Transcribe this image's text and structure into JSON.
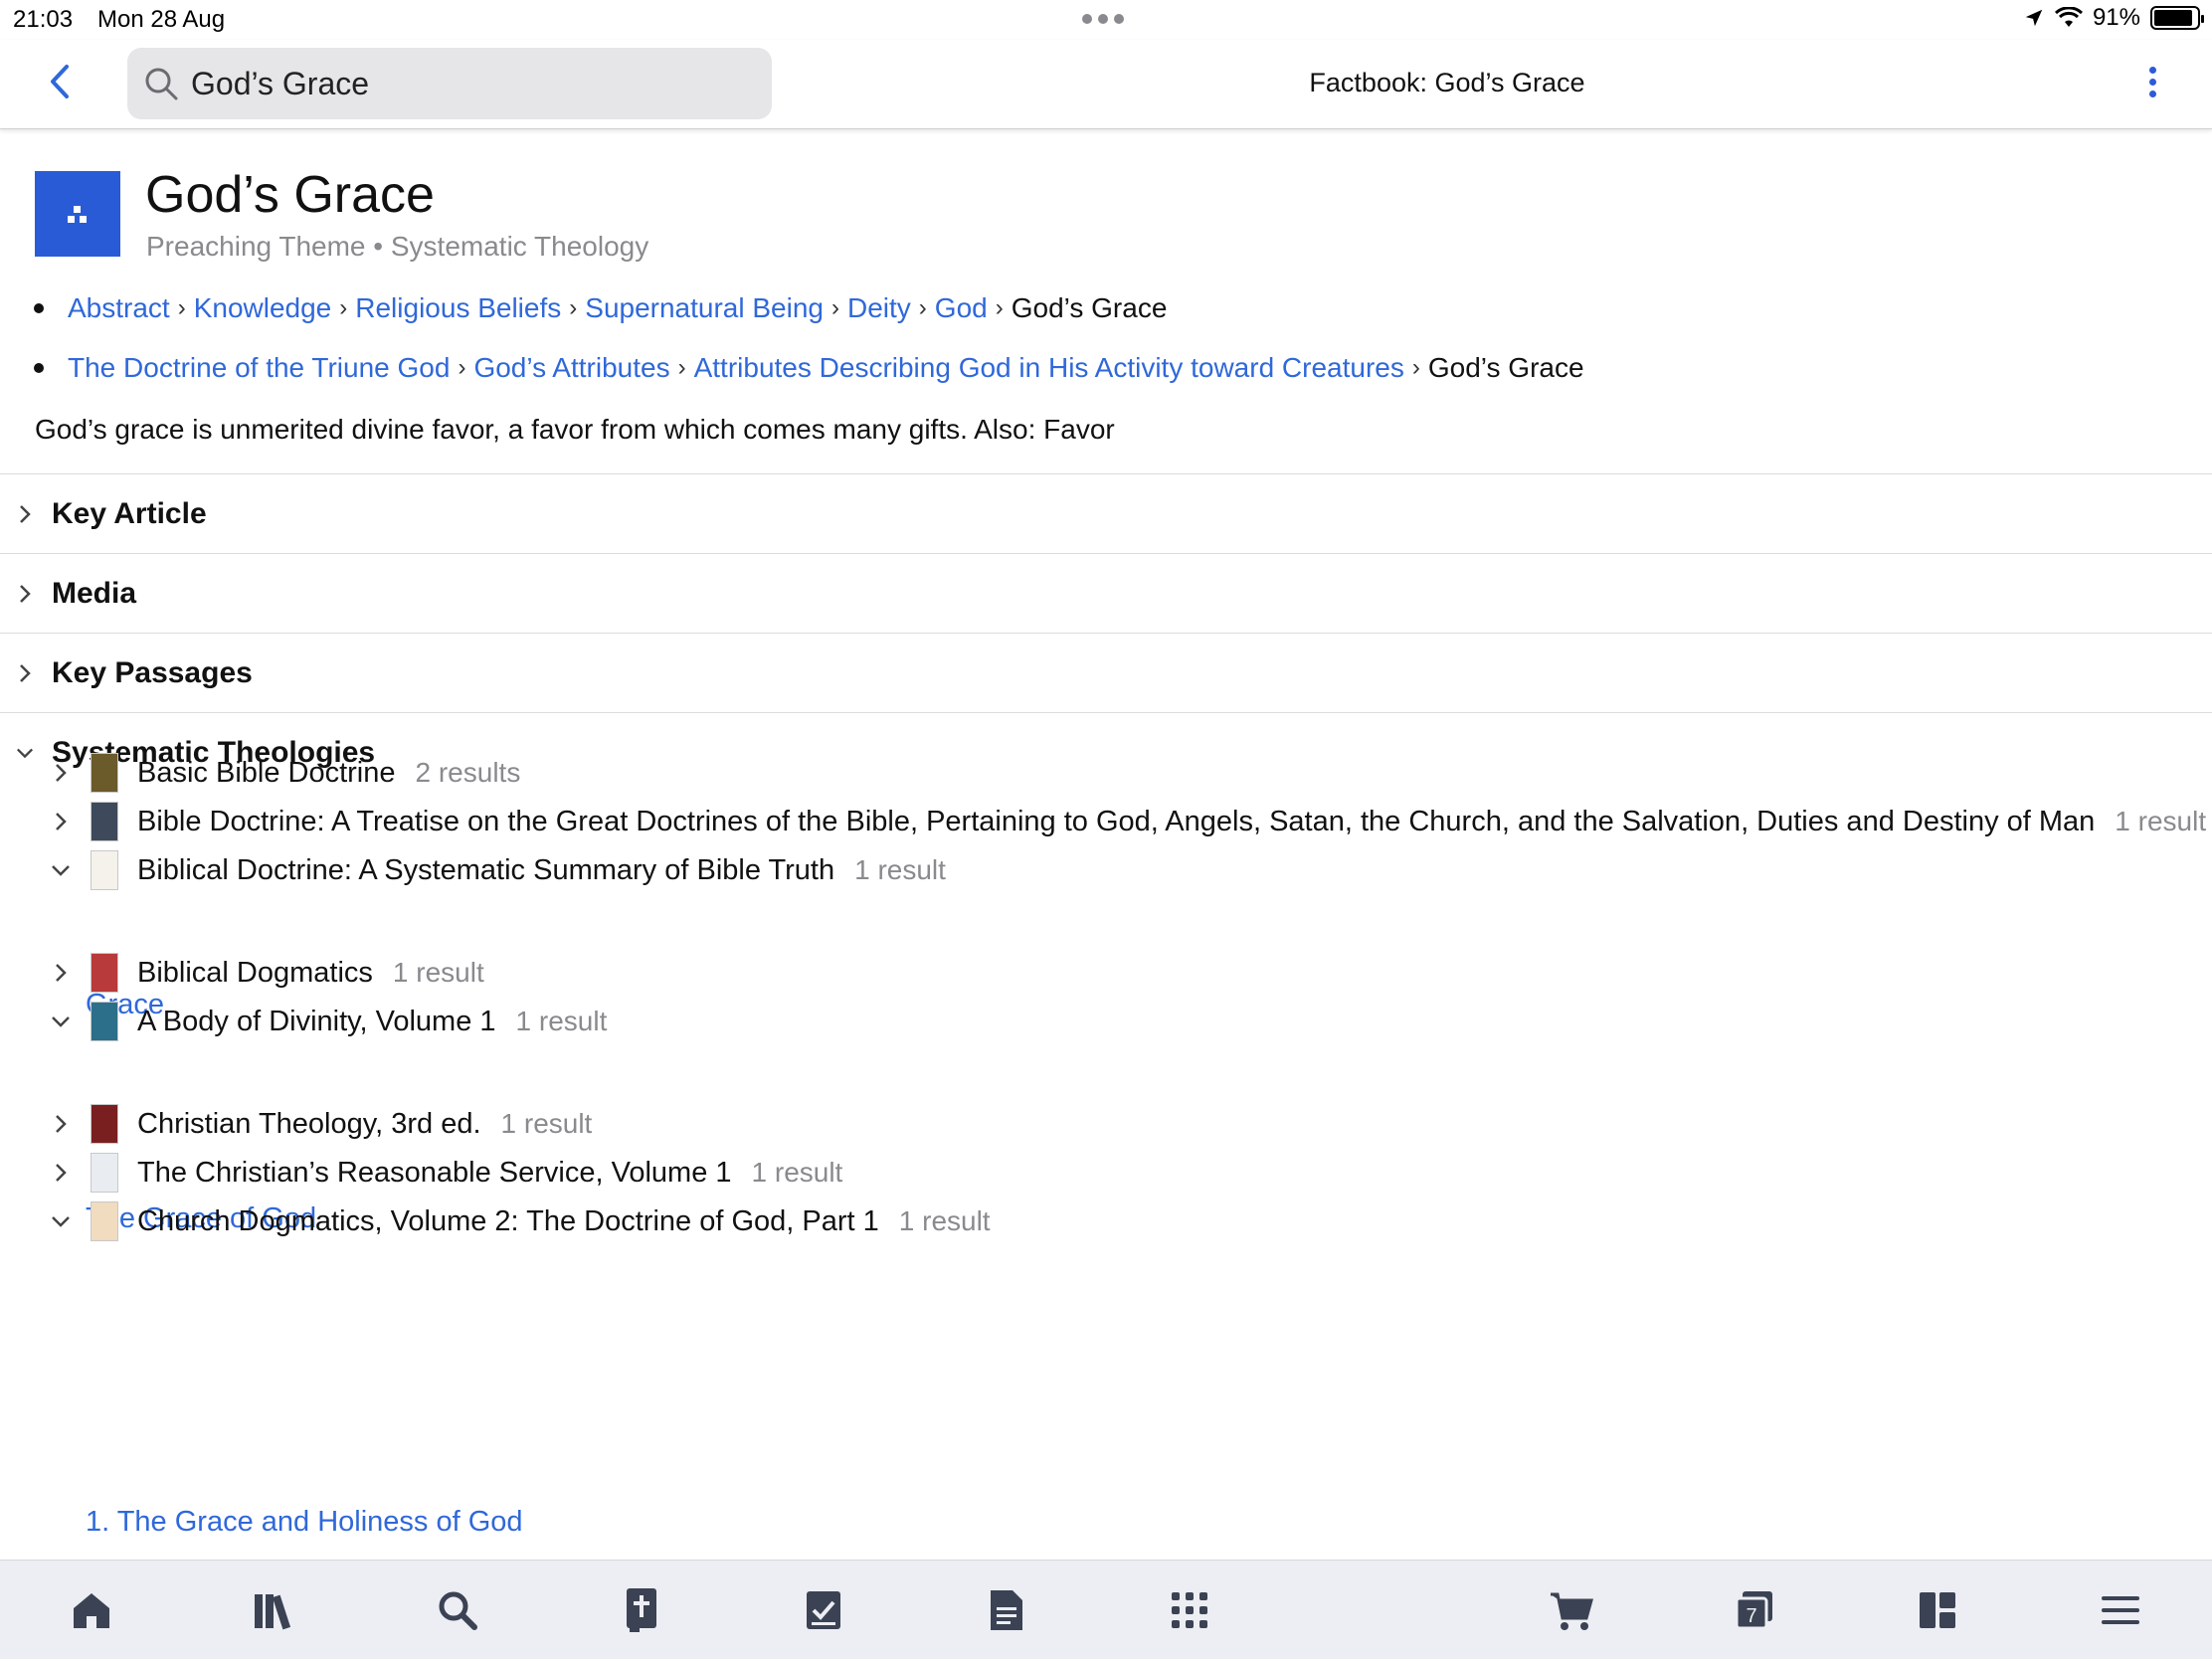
{
  "status": {
    "time": "21:03",
    "date": "Mon 28 Aug",
    "battery": "91%",
    "battery_level": 0.91
  },
  "nav": {
    "search_value": "God’s Grace",
    "title": "Factbook: God’s Grace"
  },
  "header": {
    "title": "God’s Grace",
    "subtitle": "Preaching Theme • Systematic Theology"
  },
  "breadcrumbs": [
    {
      "links": [
        "Abstract",
        "Knowledge",
        "Religious Beliefs",
        "Supernatural Being",
        "Deity",
        "God"
      ],
      "current": "God’s Grace"
    },
    {
      "links": [
        "The Doctrine of the Triune God",
        "God’s Attributes",
        "Attributes Describing God in His Activity toward Creatures"
      ],
      "current": "God’s Grace"
    }
  ],
  "separator": "›",
  "description": "God’s grace is unmerited divine favor, a favor from which comes many gifts. Also: Favor",
  "sections": [
    {
      "label": "Key Article",
      "expanded": false
    },
    {
      "label": "Media",
      "expanded": false
    },
    {
      "label": "Key Passages",
      "expanded": false
    },
    {
      "label": "Systematic Theologies",
      "expanded": true
    }
  ],
  "books": [
    {
      "title": "Basic Bible Doctrine",
      "count": "2 results",
      "expanded": false,
      "cover": "#6b5a2a"
    },
    {
      "title": "Bible Doctrine: A Treatise on the Great Doctrines of the Bible, Pertaining to God, Angels, Satan, the Church, and the Salvation, Duties and Destiny of Man",
      "count": "1 result",
      "expanded": false,
      "cover": "#3e4a5c"
    },
    {
      "title": "Biblical Doctrine: A Systematic Summary of Bible Truth",
      "count": "1 result",
      "expanded": true,
      "cover": "#f4f2ea",
      "result": "Grace"
    },
    {
      "title": "Biblical Dogmatics",
      "count": "1 result",
      "expanded": false,
      "cover": "#b83a3a"
    },
    {
      "title": "A Body of Divinity, Volume 1",
      "count": "1 result",
      "expanded": true,
      "cover": "#2c6f8a",
      "result": "The Grace of God"
    },
    {
      "title": "Christian Theology, 3rd ed.",
      "count": "1 result",
      "expanded": false,
      "cover": "#7a1f1f"
    },
    {
      "title": "The Christian’s Reasonable Service, Volume 1",
      "count": "1 result",
      "expanded": false,
      "cover": "#e9edf2"
    },
    {
      "title": "Church Dogmatics, Volume 2: The Doctrine of God, Part 1",
      "count": "1 result",
      "expanded": true,
      "cover": "#f1dcc0",
      "result": "1. The Grace and Holiness of God"
    }
  ],
  "tabbar": {
    "icons": [
      "home-icon",
      "library-icon",
      "search-icon",
      "bible-icon",
      "reading-plan-icon",
      "document-icon",
      "apps-grid-icon",
      "cart-icon",
      "tabs-icon",
      "layout-icon",
      "menu-icon"
    ],
    "tabs_count": "7"
  },
  "colors": {
    "accent": "#2f68d9",
    "icon_blue": "#2a5bd7",
    "tab_icon": "#3b4253"
  }
}
